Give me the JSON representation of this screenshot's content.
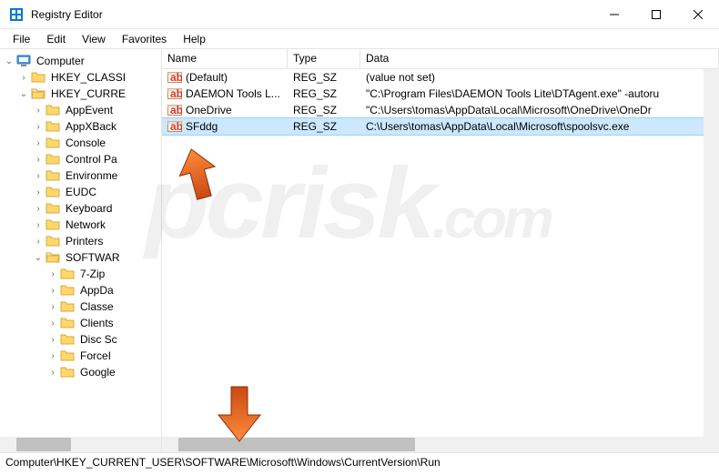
{
  "title": "Registry Editor",
  "menu": {
    "file": "File",
    "edit": "Edit",
    "view": "View",
    "favorites": "Favorites",
    "help": "Help"
  },
  "tree": {
    "root": "Computer",
    "hkcl": "HKEY_CLASSI",
    "hkcu": "HKEY_CURRE",
    "n1": "AppEvent",
    "n2": "AppXBack",
    "n3": "Console",
    "n4": "Control Pa",
    "n5": "Environme",
    "n6": "EUDC",
    "n7": "Keyboard",
    "n8": "Network",
    "n9": "Printers",
    "n10": "SOFTWAR",
    "s1": "7-Zip",
    "s2": "AppDa",
    "s3": "Classe",
    "s4": "Clients",
    "s5": "Disc Sc",
    "s6": "ForceI",
    "s7": "Google"
  },
  "cols": {
    "name": "Name",
    "type": "Type",
    "data": "Data"
  },
  "rows": [
    {
      "name": "(Default)",
      "type": "REG_SZ",
      "data": "(value not set)",
      "sel": false
    },
    {
      "name": "DAEMON Tools L...",
      "type": "REG_SZ",
      "data": "\"C:\\Program Files\\DAEMON Tools Lite\\DTAgent.exe\" -autoru",
      "sel": false
    },
    {
      "name": "OneDrive",
      "type": "REG_SZ",
      "data": "\"C:\\Users\\tomas\\AppData\\Local\\Microsoft\\OneDrive\\OneDr",
      "sel": false
    },
    {
      "name": "SFddg",
      "type": "REG_SZ",
      "data": "C:\\Users\\tomas\\AppData\\Local\\Microsoft\\spoolsvc.exe",
      "sel": true
    }
  ],
  "statusbar": "Computer\\HKEY_CURRENT_USER\\SOFTWARE\\Microsoft\\Windows\\CurrentVersion\\Run"
}
